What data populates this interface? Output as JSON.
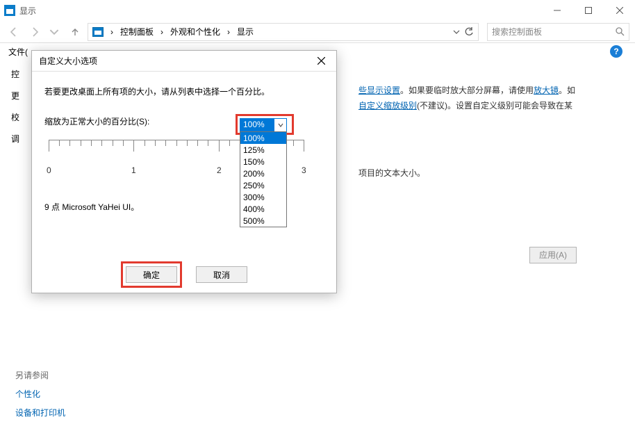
{
  "window": {
    "title": "显示",
    "breadcrumb": [
      "控制面板",
      "外观和个性化",
      "显示"
    ],
    "search_placeholder": "搜索控制面板"
  },
  "menubar": {
    "file": "文件("
  },
  "left_sidebar": {
    "i0": "控",
    "i1": "更",
    "i2": "校",
    "i3": "调"
  },
  "main": {
    "line1a": "些显示设置",
    "line1b": "。如果要临时放大部分屏幕，请使用",
    "line1c": "放大镜",
    "line1d": "。如",
    "line2a": "自定义缩放级别",
    "line2b": "(不建议)。设置自定义级别可能会导致在某",
    "only_change": "项目的文本大小。",
    "apply": "应用(A)"
  },
  "bottom": {
    "see_also": "另请参阅",
    "link1": "个性化",
    "link2": "设备和打印机"
  },
  "dialog": {
    "title": "自定义大小选项",
    "desc": "若要更改桌面上所有项的大小，请从列表中选择一个百分比。",
    "scale_label": "缩放为正常大小的百分比(S):",
    "selected": "100%",
    "options": [
      "100%",
      "125%",
      "150%",
      "200%",
      "250%",
      "300%",
      "400%",
      "500%"
    ],
    "ruler": {
      "l0": "0",
      "l1": "1",
      "l2": "2",
      "l3": "3"
    },
    "sample": "9 点 Microsoft YaHei UI。",
    "ok": "确定",
    "cancel": "取消"
  }
}
